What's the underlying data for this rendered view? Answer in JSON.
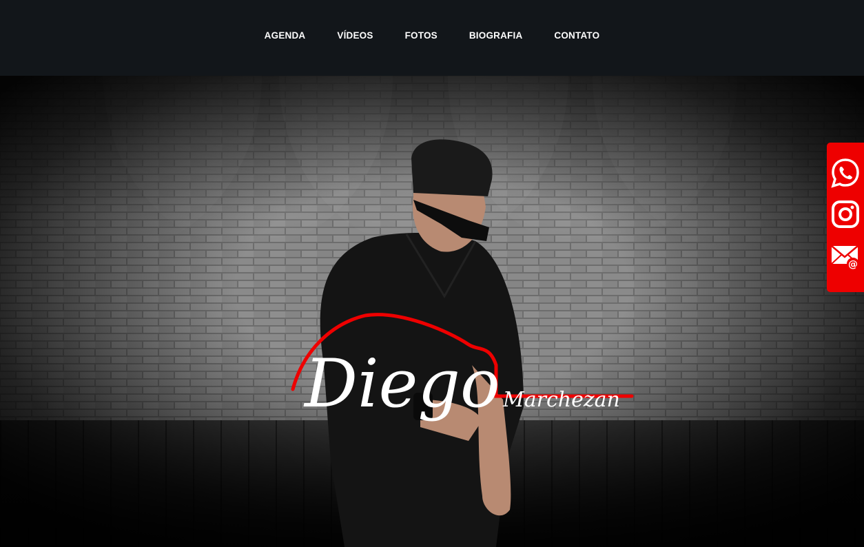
{
  "nav": {
    "items": [
      {
        "label": "AGENDA"
      },
      {
        "label": "VÍDEOS"
      },
      {
        "label": "FOTOS"
      },
      {
        "label": "BIOGRAFIA"
      },
      {
        "label": "CONTATO"
      }
    ]
  },
  "hero": {
    "logo": {
      "first": "Diego",
      "last": "Marchezan"
    }
  },
  "social": {
    "items": [
      {
        "icon": "whatsapp-icon"
      },
      {
        "icon": "instagram-icon"
      },
      {
        "icon": "email-icon"
      }
    ]
  },
  "colors": {
    "topbar": "#12161a",
    "accent": "#ee0000",
    "nav_text": "#ffffff"
  }
}
